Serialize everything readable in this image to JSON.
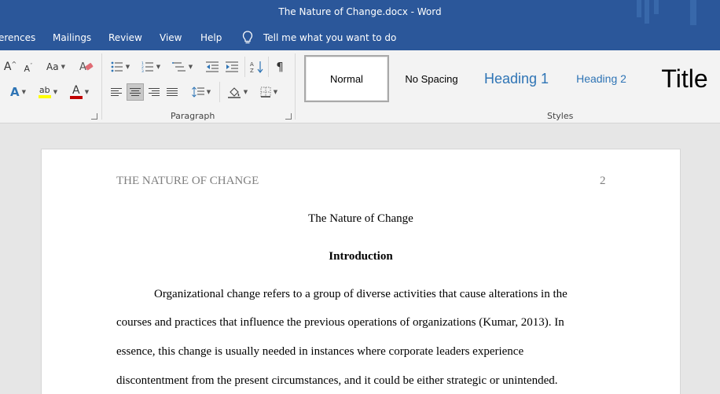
{
  "titlebar": {
    "title": "The Nature of Change.docx  -  Word"
  },
  "menubar": {
    "tabs": [
      "erences",
      "Mailings",
      "Review",
      "View",
      "Help"
    ],
    "tell_me": "Tell me what you want to do"
  },
  "ribbon": {
    "font_group": {
      "grow_font": "A",
      "shrink_font": "A",
      "change_case": "Aa",
      "text_effects": "A",
      "highlight": "ab",
      "font_color": "A"
    },
    "paragraph_group": {
      "label": "Paragraph",
      "pilcrow": "¶"
    },
    "styles_group": {
      "label": "Styles",
      "items": [
        "Normal",
        "No Spacing",
        "Heading 1",
        "Heading 2",
        "Title"
      ],
      "selected": "Normal"
    },
    "colors": {
      "highlight": "#ffff00",
      "font_color": "#c00000",
      "heading": "#2e74b5"
    }
  },
  "document": {
    "running_head": "THE NATURE OF CHANGE",
    "page_number": "2",
    "title": "The Nature of Change",
    "heading": "Introduction",
    "paragraph_lines": [
      "Organizational change refers to a group of diverse activities that cause alterations in the",
      "courses and practices that influence the previous operations of organizations (Kumar, 2013). In",
      "essence, this change is usually needed in instances where corporate leaders experience",
      "discontentment from the present circumstances, and it could be either strategic or unintended."
    ]
  }
}
